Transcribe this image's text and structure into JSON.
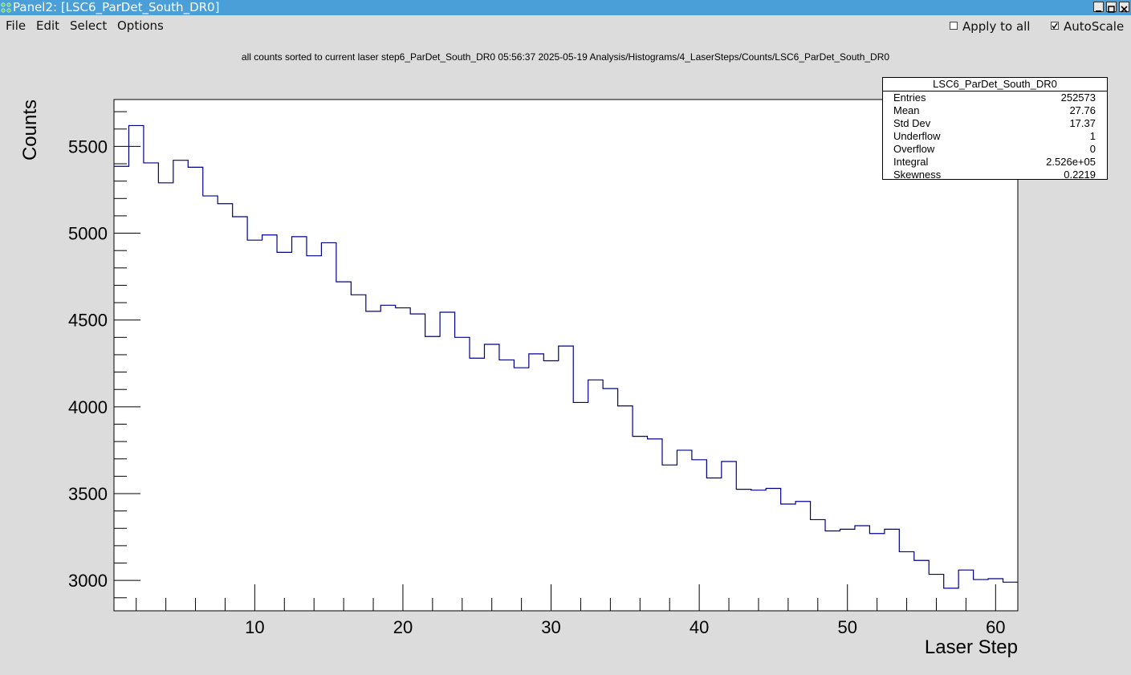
{
  "window": {
    "title": "Panel2: [LSC6_ParDet_South_DR0]"
  },
  "menu": {
    "file": "File",
    "edit": "Edit",
    "select": "Select",
    "options": "Options"
  },
  "controls": {
    "apply_to_all": {
      "label": "Apply to all",
      "checked": false
    },
    "autoscale": {
      "label": "AutoScale",
      "checked": true
    }
  },
  "plot": {
    "title": "all counts sorted to current laser step6_ParDet_South_DR0  05:56:37  2025-05-19  Analysis/Histograms/4_LaserSteps/Counts/LSC6_ParDet_South_DR0"
  },
  "stats": {
    "name": "LSC6_ParDet_South_DR0",
    "rows": [
      {
        "label": "Entries",
        "value": "252573"
      },
      {
        "label": "Mean",
        "value": "27.76"
      },
      {
        "label": "Std Dev",
        "value": "17.37"
      },
      {
        "label": "Underflow",
        "value": "1"
      },
      {
        "label": "Overflow",
        "value": "0"
      },
      {
        "label": "Integral",
        "value": "2.526e+05"
      },
      {
        "label": "Skewness",
        "value": "0.2219"
      }
    ]
  },
  "chart_data": {
    "type": "line",
    "style": "step-histogram",
    "xlabel": "Laser Step",
    "ylabel": "Counts",
    "xlim": [
      0.5,
      61.5
    ],
    "ylim": [
      2825,
      5770
    ],
    "x_ticks": [
      10,
      20,
      30,
      40,
      50,
      60
    ],
    "y_ticks": [
      3000,
      3500,
      4000,
      4500,
      5000,
      5500
    ],
    "line_color": "#00008b",
    "x": [
      1,
      2,
      3,
      4,
      5,
      6,
      7,
      8,
      9,
      10,
      11,
      12,
      13,
      14,
      15,
      16,
      17,
      18,
      19,
      20,
      21,
      22,
      23,
      24,
      25,
      26,
      27,
      28,
      29,
      30,
      31,
      32,
      33,
      34,
      35,
      36,
      37,
      38,
      39,
      40,
      41,
      42,
      43,
      44,
      45,
      46,
      47,
      48,
      49,
      50,
      51,
      52,
      53,
      54,
      55,
      56,
      57,
      58,
      59,
      60,
      61
    ],
    "values": [
      5385,
      5620,
      5405,
      5290,
      5420,
      5380,
      5215,
      5170,
      5095,
      4960,
      4990,
      4890,
      4980,
      4870,
      4945,
      4720,
      4645,
      4550,
      4585,
      4570,
      4535,
      4405,
      4545,
      4400,
      4280,
      4360,
      4270,
      4225,
      4305,
      4265,
      4350,
      4025,
      4155,
      4105,
      4005,
      3830,
      3815,
      3665,
      3750,
      3695,
      3590,
      3685,
      3525,
      3520,
      3530,
      3440,
      3455,
      3350,
      3285,
      3295,
      3315,
      3270,
      3295,
      3165,
      3115,
      3035,
      2955,
      3060,
      3005,
      3010,
      2990
    ]
  }
}
